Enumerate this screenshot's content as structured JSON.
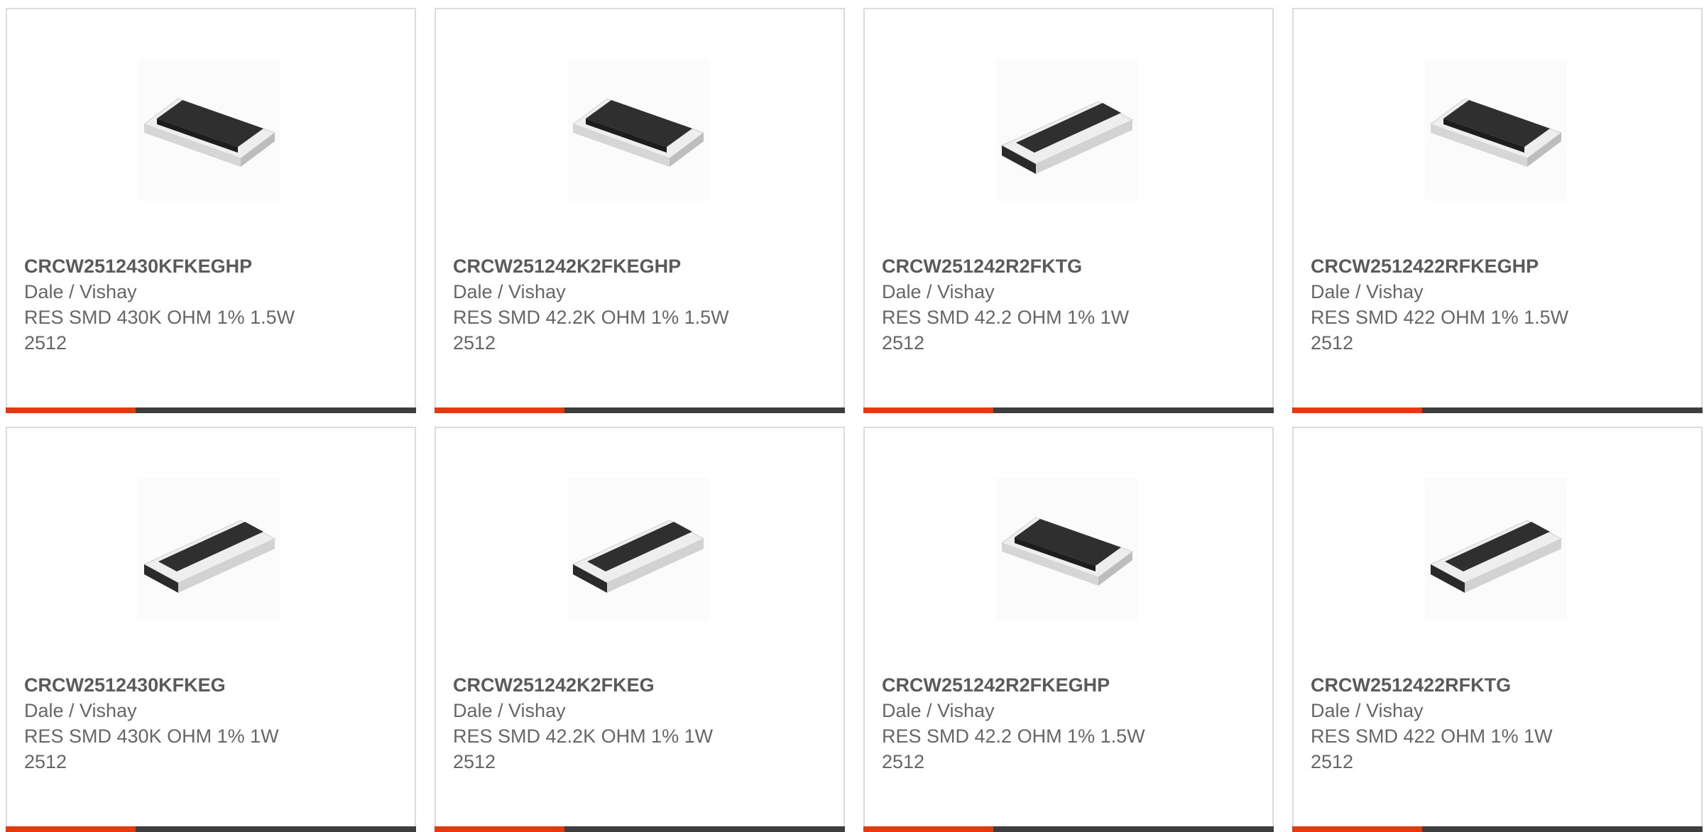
{
  "colors": {
    "accent": "#e03c10",
    "bar_dark": "#3e3e3e",
    "text": "#666666",
    "border": "#dcdcdc"
  },
  "products": [
    {
      "part": "CRCW2512430KFKEGHP",
      "maker": "Dale / Vishay",
      "desc": "RES SMD 430K OHM 1% 1.5W",
      "pkg": "2512",
      "image_icon": "smd-resistor-chip-icon"
    },
    {
      "part": "CRCW251242K2FKEGHP",
      "maker": "Dale / Vishay",
      "desc": "RES SMD 42.2K OHM 1% 1.5W",
      "pkg": "2512",
      "image_icon": "smd-resistor-chip-icon"
    },
    {
      "part": "CRCW251242R2FKTG",
      "maker": "Dale / Vishay",
      "desc": "RES SMD 42.2 OHM 1% 1W",
      "pkg": "2512",
      "image_icon": "smd-resistor-chip-icon"
    },
    {
      "part": "CRCW2512422RFKEGHP",
      "maker": "Dale / Vishay",
      "desc": "RES SMD 422 OHM 1% 1.5W",
      "pkg": "2512",
      "image_icon": "smd-resistor-chip-icon"
    },
    {
      "part": "CRCW2512430KFKEG",
      "maker": "Dale / Vishay",
      "desc": "RES SMD 430K OHM 1% 1W",
      "pkg": "2512",
      "image_icon": "smd-resistor-chip-icon"
    },
    {
      "part": "CRCW251242K2FKEG",
      "maker": "Dale / Vishay",
      "desc": "RES SMD 42.2K OHM 1% 1W",
      "pkg": "2512",
      "image_icon": "smd-resistor-chip-icon"
    },
    {
      "part": "CRCW251242R2FKEGHP",
      "maker": "Dale / Vishay",
      "desc": "RES SMD 42.2 OHM 1% 1.5W",
      "pkg": "2512",
      "image_icon": "smd-resistor-chip-icon"
    },
    {
      "part": "CRCW2512422RFKTG",
      "maker": "Dale / Vishay",
      "desc": "RES SMD 422 OHM 1% 1W",
      "pkg": "2512",
      "image_icon": "smd-resistor-chip-icon"
    }
  ]
}
